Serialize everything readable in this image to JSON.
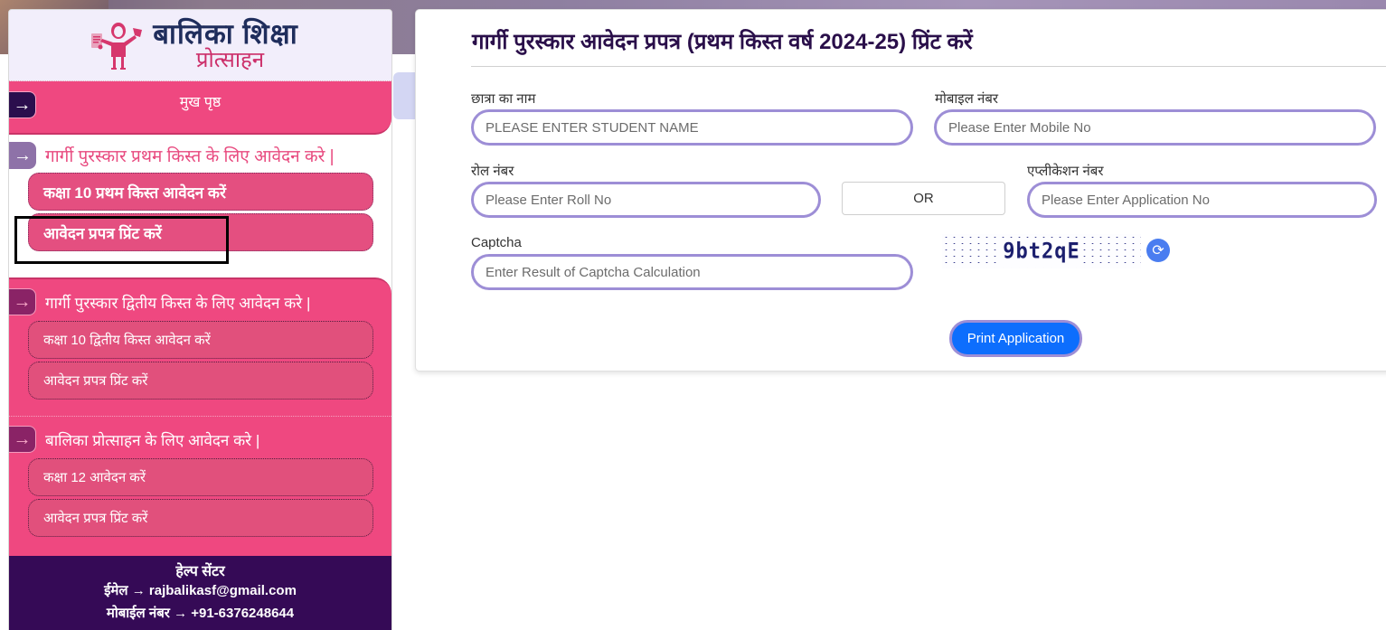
{
  "sidebar": {
    "logo": {
      "title": "बालिका  शिक्षा",
      "subtitle": "प्रोत्साहन",
      "icon": "girl-graduate-icon"
    },
    "home": {
      "label": "मुख पृष्ठ",
      "icon": "arrow-right-icon"
    },
    "sections": [
      {
        "title": "गार्गी पुरस्कार प्रथम किस्त के लिए आवेदन करे |",
        "items": [
          {
            "label": "कक्षा 10 प्रथम किस्त आवेदन करें"
          },
          {
            "label": "आवेदन प्रपत्र प्रिंट करें",
            "selected": true
          }
        ]
      },
      {
        "title": "गार्गी पुरस्कार द्वितीय किस्त के लिए आवेदन करे |",
        "items": [
          {
            "label": "कक्षा 10 द्वितीय किस्त आवेदन करें"
          },
          {
            "label": "आवेदन प्रपत्र प्रिंट करें"
          }
        ]
      },
      {
        "title": "बालिका प्रोत्साहन के लिए आवेदन करे |",
        "items": [
          {
            "label": "कक्षा 12 आवेदन करें"
          },
          {
            "label": "आवेदन प्रपत्र प्रिंट करें"
          }
        ]
      }
    ],
    "help": {
      "title": "हेल्प सेंटर",
      "email_line": "ईमेल → rajbalikasf@gmail.com",
      "mobile_line": "मोबाईल नंबर → +91-6376248644"
    }
  },
  "form": {
    "title": "गार्गी पुरस्कार आवेदन प्रपत्र (प्रथम किस्त वर्ष 2024-25) प्रिंट करें",
    "student_name": {
      "label": "छात्रा का नाम",
      "placeholder": "PLEASE ENTER STUDENT NAME",
      "value": ""
    },
    "mobile": {
      "label": "मोबाइल नंबर",
      "placeholder": "Please Enter Mobile No",
      "value": ""
    },
    "roll_no": {
      "label": "रोल नंबर",
      "placeholder": "Please Enter Roll No",
      "value": ""
    },
    "or_label": "OR",
    "application_no": {
      "label": "एप्लीकेशन नंबर",
      "placeholder": "Please Enter Application No",
      "value": ""
    },
    "captcha": {
      "label": "Captcha",
      "placeholder": "Enter Result of Captcha Calculation",
      "value": "",
      "image_text": "9bt2qE",
      "refresh_icon": "refresh-icon"
    },
    "submit_label": "Print Application"
  },
  "colors": {
    "sidebar_pink": "#ef4880",
    "help_bg": "#350a56",
    "input_border": "#9d8ed6",
    "primary_button": "#0d6efd",
    "title": "#2a0f4a"
  }
}
